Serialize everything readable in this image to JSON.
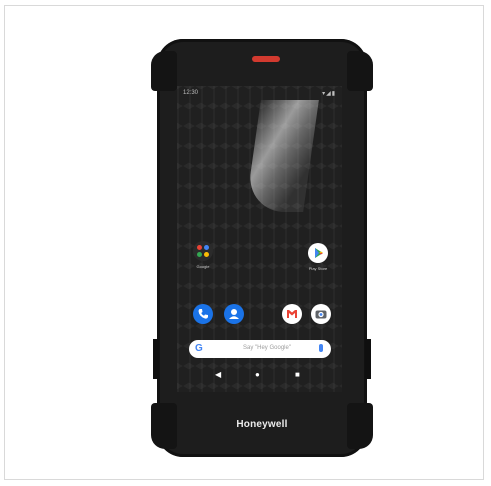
{
  "device": {
    "brand": "Honeywell",
    "status_time": "12:30",
    "status_icons": "▾◢▮"
  },
  "home_screen": {
    "apps": [
      {
        "label": "Google",
        "icon": "google-apps-folder-icon"
      },
      {
        "label": "Play Store",
        "icon": "play-store-icon"
      }
    ],
    "dock": [
      {
        "icon": "phone-icon"
      },
      {
        "icon": "contacts-icon"
      },
      {
        "icon": "gmail-icon"
      },
      {
        "icon": "camera-icon"
      }
    ],
    "search": {
      "logo": "G",
      "placeholder": "Say \"Hey Google\""
    },
    "navigation": {
      "back": "◀",
      "home": "●",
      "recents": "■"
    }
  },
  "colors": {
    "accent_red": "#d23a2f",
    "device_body": "#1d1d1d",
    "google_blue": "#4285f4"
  }
}
